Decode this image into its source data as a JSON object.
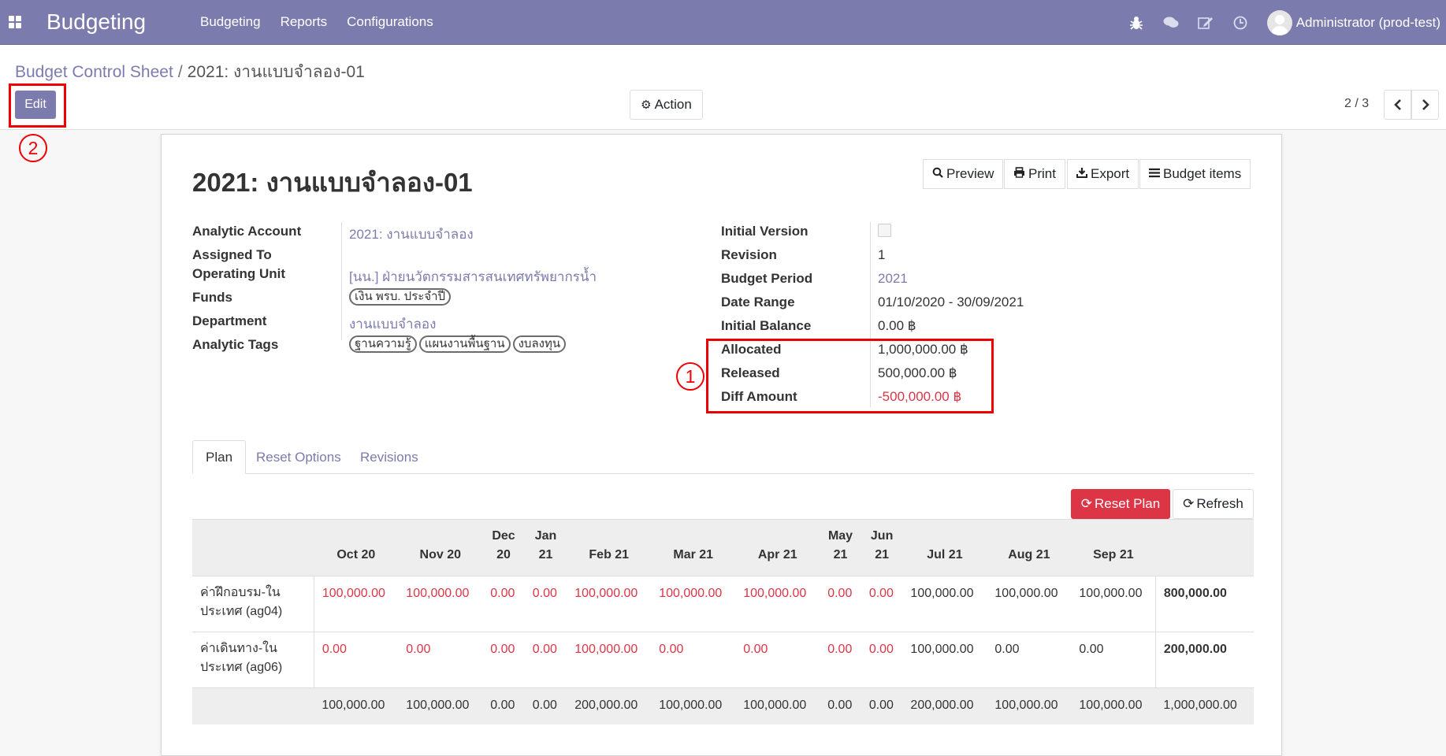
{
  "navbar": {
    "app_name": "Budgeting",
    "menu": [
      "Budgeting",
      "Reports",
      "Configurations"
    ],
    "systray_icons": [
      "bug-icon",
      "chat-icon",
      "edit-icon",
      "clock-icon"
    ],
    "user": "Administrator (prod-test)"
  },
  "breadcrumb": {
    "parent": "Budget Control Sheet",
    "separator": "/",
    "current": "2021: งานแบบจำลอง-01"
  },
  "control": {
    "edit_label": "Edit",
    "action_label": "Action",
    "pager": "2 / 3"
  },
  "annotations": [
    "1",
    "2"
  ],
  "sheet": {
    "title": "2021: งานแบบจำลอง-01",
    "buttons": {
      "preview": "Preview",
      "print": "Print",
      "export": "Export",
      "budget_items": "Budget items"
    },
    "left_fields": {
      "analytic_account_label": "Analytic Account",
      "analytic_account": "2021: งานแบบจำลอง",
      "assigned_to_label": "Assigned To",
      "operating_unit_label": "Operating Unit",
      "operating_unit": "[นน.] ฝ่ายนวัตกรรมสารสนเทศทรัพยากรน้ำ",
      "funds_label": "Funds",
      "funds": "เงิน พรบ. ประจำปี",
      "department_label": "Department",
      "department": "งานแบบจำลอง",
      "analytic_tags_label": "Analytic Tags",
      "analytic_tags": [
        "ฐานความรู้",
        "แผนงานพื้นฐาน",
        "งบลงทุน"
      ]
    },
    "right_fields": {
      "initial_version_label": "Initial Version",
      "initial_version_checked": false,
      "revision_label": "Revision",
      "revision": "1",
      "budget_period_label": "Budget Period",
      "budget_period": "2021",
      "date_range_label": "Date Range",
      "date_range": "01/10/2020 - 30/09/2021",
      "initial_balance_label": "Initial Balance",
      "initial_balance": "0.00 ฿",
      "allocated_label": "Allocated",
      "allocated": "1,000,000.00 ฿",
      "released_label": "Released",
      "released": "500,000.00 ฿",
      "diff_amount_label": "Diff Amount",
      "diff_amount": "-500,000.00 ฿"
    },
    "tabs": [
      "Plan",
      "Reset Options",
      "Revisions"
    ],
    "reset_plan_label": "Reset Plan",
    "refresh_label": "Refresh",
    "table": {
      "headers": [
        [
          "",
          ""
        ],
        [
          "",
          "Oct 20"
        ],
        [
          "",
          "Nov 20"
        ],
        [
          "Dec",
          "20"
        ],
        [
          "Jan",
          "21"
        ],
        [
          "",
          "Feb 21"
        ],
        [
          "",
          "Mar 21"
        ],
        [
          "",
          "Apr 21"
        ],
        [
          "May",
          "21"
        ],
        [
          "Jun",
          "21"
        ],
        [
          "",
          "Jul 21"
        ],
        [
          "",
          "Aug 21"
        ],
        [
          "",
          "Sep 21"
        ],
        [
          "",
          ""
        ]
      ],
      "rows": [
        {
          "name": [
            "ค่าฝึกอบรม-ใน",
            "ประเทศ (ag04)"
          ],
          "values": [
            "100,000.00",
            "100,000.00",
            "0.00",
            "0.00",
            "100,000.00",
            "100,000.00",
            "100,000.00",
            "0.00",
            "0.00",
            "100,000.00",
            "100,000.00",
            "100,000.00"
          ],
          "red": [
            true,
            true,
            true,
            true,
            true,
            true,
            true,
            true,
            true,
            false,
            false,
            false
          ],
          "total": "800,000.00"
        },
        {
          "name": [
            "ค่าเดินทาง-ใน",
            "ประเทศ (ag06)"
          ],
          "values": [
            "0.00",
            "0.00",
            "0.00",
            "0.00",
            "100,000.00",
            "0.00",
            "0.00",
            "0.00",
            "0.00",
            "100,000.00",
            "0.00",
            "0.00"
          ],
          "red": [
            true,
            true,
            true,
            true,
            true,
            true,
            true,
            true,
            true,
            false,
            false,
            false
          ],
          "total": "200,000.00"
        }
      ],
      "footer": [
        "100,000.00",
        "100,000.00",
        "0.00",
        "0.00",
        "200,000.00",
        "100,000.00",
        "100,000.00",
        "0.00",
        "0.00",
        "200,000.00",
        "100,000.00",
        "100,000.00",
        "1,000,000.00"
      ]
    }
  }
}
